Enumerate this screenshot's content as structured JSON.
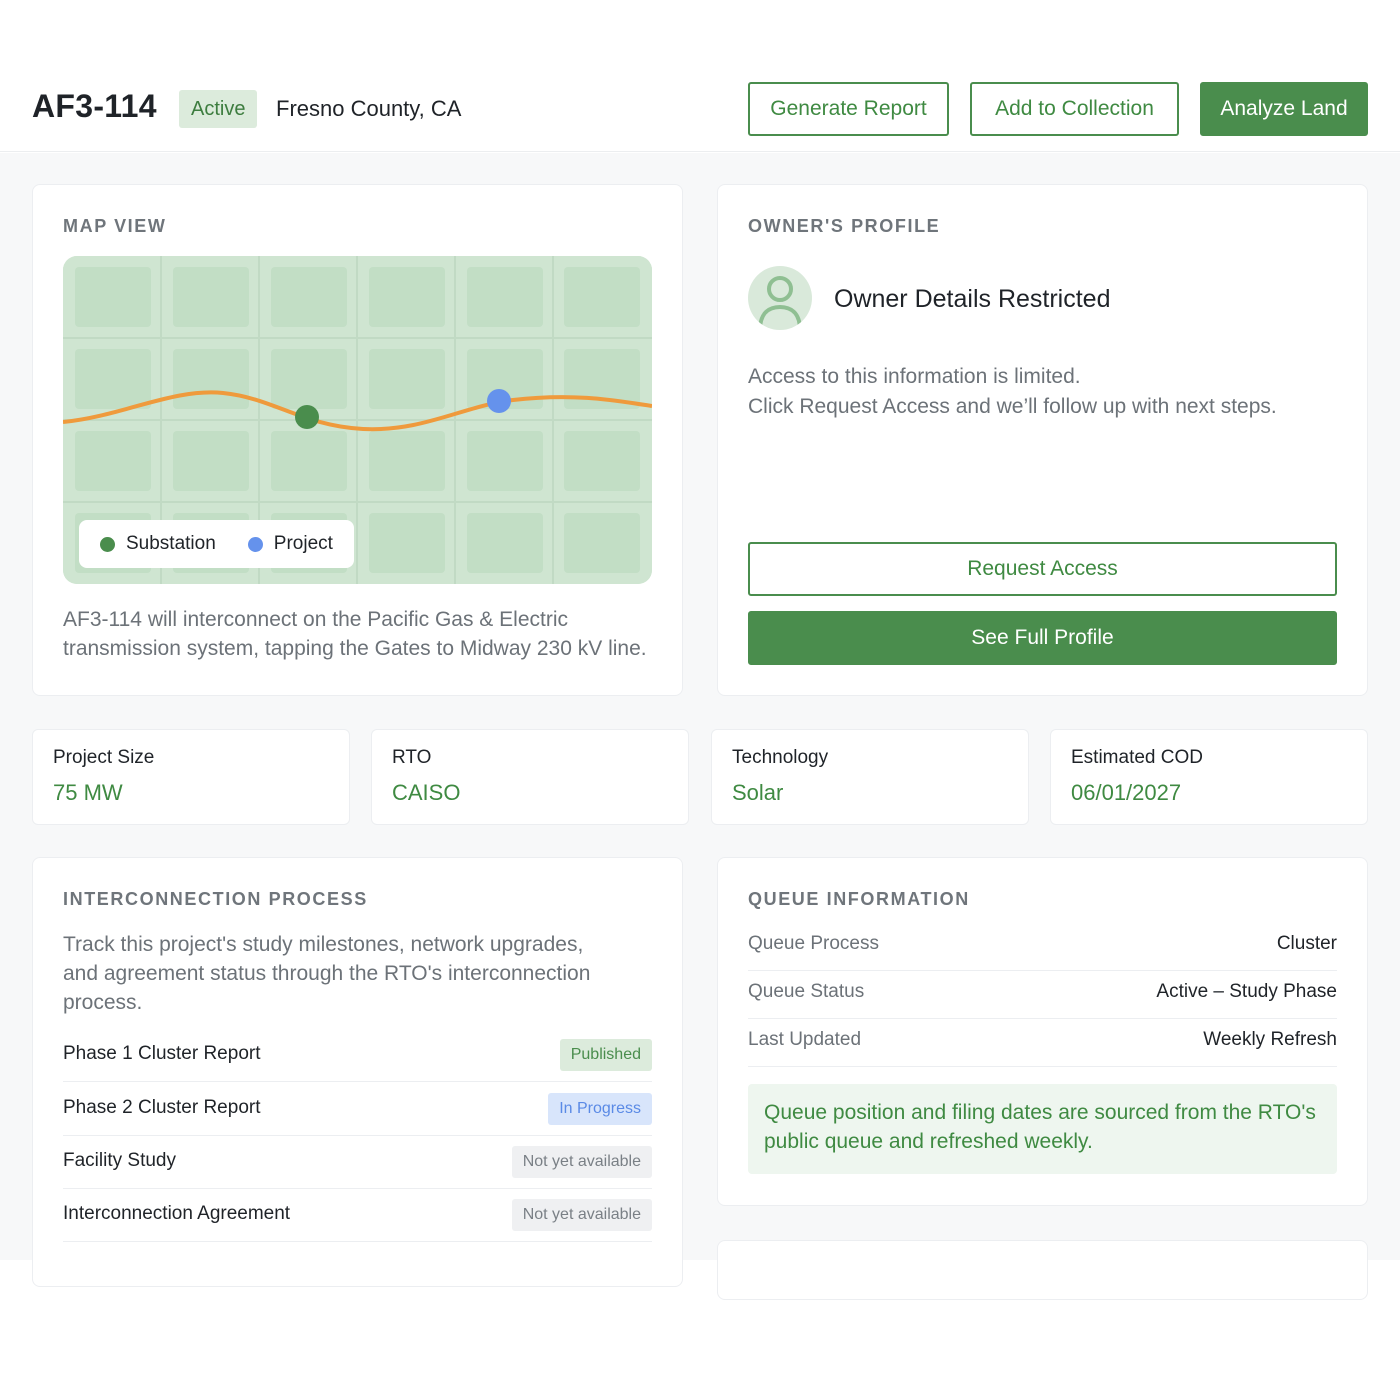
{
  "header": {
    "project_id": "AF3-114",
    "status": "Active",
    "location": "Fresno County, CA",
    "buttons": {
      "generate_report": "Generate Report",
      "add_to_collection": "Add to Collection",
      "analyze_land": "Analyze Land"
    }
  },
  "colors": {
    "accent": "#4a8d4d",
    "substation": "#4a8d4d",
    "project": "#6592ec",
    "line": "#ef9a3c"
  },
  "map_view": {
    "title": "MAP VIEW",
    "legend": {
      "substation": "Substation",
      "project": "Project"
    },
    "description": "AF3-114 will interconnect on the Pacific Gas & Electric transmission system, tapping the Gates to Midway 230 kV line."
  },
  "owner_profile": {
    "title": "OWNER'S PROFILE",
    "avatar_icon": "user-icon",
    "name": "Owner Details Restricted",
    "line1": "Access to this information is limited.",
    "line2": "Click Request Access and we’ll follow up with next steps.",
    "request_access": "Request Access",
    "see_full_profile": "See Full Profile"
  },
  "stats": [
    {
      "label": "Project Size",
      "value": "75 MW"
    },
    {
      "label": "RTO",
      "value": "CAISO"
    },
    {
      "label": "Technology",
      "value": "Solar"
    },
    {
      "label": "Estimated COD",
      "value": "06/01/2027"
    }
  ],
  "interconnection": {
    "title": "INTERCONNECTION PROCESS",
    "description": "Track this project's study milestones, network upgrades, and agreement status through the RTO's interconnection process.",
    "milestones": [
      {
        "label": "Phase 1 Cluster Report",
        "status": "Published"
      },
      {
        "label": "Phase 2 Cluster Report",
        "status": "In Progress"
      },
      {
        "label": "Facility Study",
        "status": "Not yet available"
      },
      {
        "label": "Interconnection Agreement",
        "status": "Not yet available"
      }
    ]
  },
  "queue": {
    "title": "QUEUE INFORMATION",
    "rows": [
      {
        "label": "Queue Process",
        "value": "Cluster"
      },
      {
        "label": "Queue Status",
        "value": "Active – Study Phase"
      },
      {
        "label": "Last Updated",
        "value": "Weekly Refresh"
      }
    ],
    "note": "Queue position and filing dates are sourced from the RTO's public queue and refreshed weekly."
  }
}
